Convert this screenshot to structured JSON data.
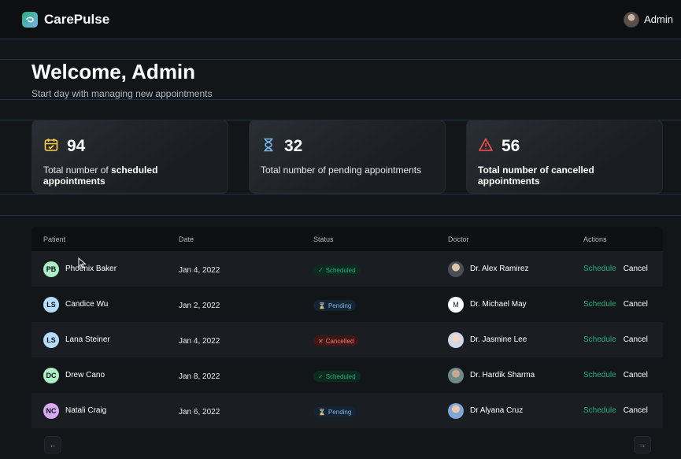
{
  "header": {
    "brand": "CarePulse",
    "user_name": "Admin"
  },
  "welcome": {
    "title": "Welcome, Admin",
    "subtitle": "Start day with managing new appointments"
  },
  "stats": [
    {
      "count": "94",
      "label_pre": "Total number of ",
      "label_bold": "scheduled appointments",
      "icon": "calendar-icon",
      "color": "#ffd147"
    },
    {
      "count": "32",
      "label_pre": "Total number of pending appointments",
      "label_bold": "",
      "icon": "hourglass-icon",
      "color": "#79b5ec"
    },
    {
      "count": "56",
      "label_pre": "",
      "label_bold": "Total number of cancelled  appointments",
      "icon": "warning-icon",
      "color": "#ff4f4e"
    }
  ],
  "table": {
    "headers": [
      "Patient",
      "Date",
      "Status",
      "Doctor",
      "Actions"
    ],
    "rows": [
      {
        "initials": "PB",
        "patient": "Phoenix Baker",
        "date": "Jan 4, 2022",
        "status": "Scheduled",
        "doctor": "Dr. Alex Ramirez",
        "avatar_color": "#abefc6"
      },
      {
        "initials": "LS",
        "patient": "Candice Wu",
        "date": "Jan 2, 2022",
        "status": "Pending",
        "doctor": "Dr. Michael May",
        "avatar_color": "#b2ddff"
      },
      {
        "initials": "LS",
        "patient": "Lana Steiner",
        "date": "Jan 4, 2022",
        "status": "Cancelled",
        "doctor": "Dr. Jasmine Lee",
        "avatar_color": "#b2ddff"
      },
      {
        "initials": "DC",
        "patient": "Drew Cano",
        "date": "Jan 8, 2022",
        "status": "Scheduled",
        "doctor": "Dr. Hardik Sharma",
        "avatar_color": "#abefc6"
      },
      {
        "initials": "NC",
        "patient": "Natali Craig",
        "date": "Jan 6, 2022",
        "status": "Pending",
        "doctor": "Dr Alyana Cruz",
        "avatar_color": "#d9a8f5"
      }
    ],
    "action_schedule": "Schedule",
    "action_cancel": "Cancel",
    "doctor_m_initial": "M"
  },
  "pagination": {
    "prev_symbol": "←",
    "next_symbol": "→"
  },
  "colors": {
    "green": "#24ae7c",
    "blue": "#79b5ec",
    "red": "#f37877"
  }
}
